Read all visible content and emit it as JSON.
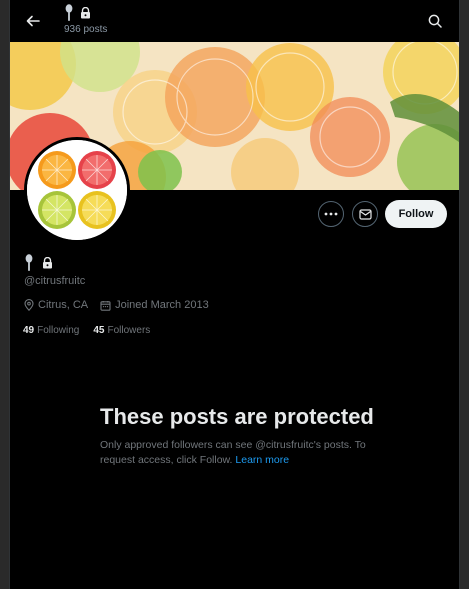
{
  "header": {
    "posts_count": "936 posts"
  },
  "profile": {
    "handle": "@citrusfruitc",
    "location": "Citrus, CA",
    "joined": "Joined March 2013",
    "following_count": "49",
    "following_label": "Following",
    "followers_count": "45",
    "followers_label": "Followers"
  },
  "actions": {
    "follow_label": "Follow"
  },
  "protected": {
    "title": "These posts are protected",
    "body": "Only approved followers can see @citrusfruitc's posts. To request access, click Follow. ",
    "learn_more": "Learn more"
  },
  "icons": {
    "back": "arrow-left-icon",
    "search": "search-icon",
    "more": "ellipsis-icon",
    "message": "envelope-icon",
    "location": "map-pin-icon",
    "joined": "calendar-icon",
    "lock": "lock-icon",
    "name_emoji": "spoon-icon"
  },
  "colors": {
    "background": "#000000",
    "text": "#e7e9ea",
    "muted": "#71767b",
    "link": "#1d9bf0",
    "follow_button_bg": "#eff3f4"
  }
}
